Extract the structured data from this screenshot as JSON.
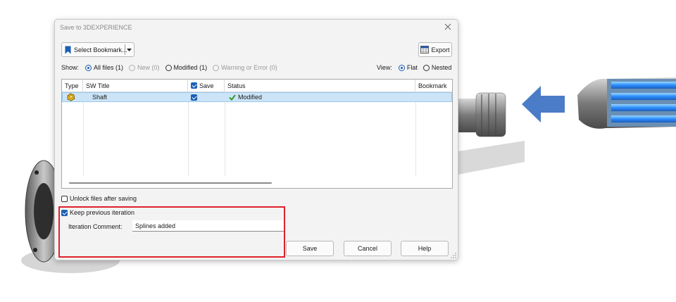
{
  "dialog": {
    "title": "Save to 3DEXPERIENCE",
    "close_icon": "close-icon"
  },
  "toolbar": {
    "bookmark_label": "Select Bookmark...",
    "export_label": "Export"
  },
  "show": {
    "label": "Show:",
    "options": [
      {
        "label": "All files (1)",
        "selected": true,
        "enabled": true
      },
      {
        "label": "New (0)",
        "selected": false,
        "enabled": false
      },
      {
        "label": "Modified (1)",
        "selected": false,
        "enabled": true
      },
      {
        "label": "Warning or Error (0)",
        "selected": false,
        "enabled": false
      }
    ]
  },
  "view": {
    "label": "View:",
    "options": [
      {
        "label": "Flat",
        "selected": true
      },
      {
        "label": "Nested",
        "selected": false
      }
    ]
  },
  "table": {
    "columns": [
      "Type",
      "SW Title",
      "Save",
      "Status",
      "Bookmark"
    ],
    "rows": [
      {
        "type_icon": "part-icon",
        "title": "Shaft",
        "save": true,
        "status": "Modified",
        "bookmark": ""
      }
    ]
  },
  "options": {
    "unlock_label": "Unlock files after saving",
    "unlock_checked": false,
    "keep_label": "Keep previous iteration",
    "keep_checked": true,
    "comment_label": "Iteration Comment:",
    "comment_value": "Splines added"
  },
  "buttons": {
    "save": "Save",
    "cancel": "Cancel",
    "help": "Help"
  },
  "colors": {
    "accent": "#1a5fb4",
    "selection": "#cce4f7",
    "highlight_box": "#e0202a",
    "arrow": "#4a7cc7"
  }
}
